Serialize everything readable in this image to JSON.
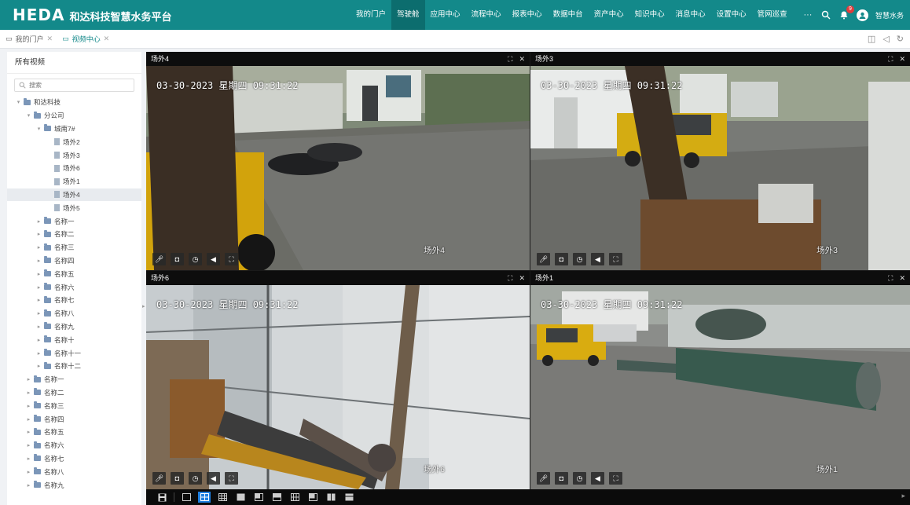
{
  "header": {
    "logo": "HEDA",
    "platform": "和达科技智慧水务平台",
    "nav": [
      {
        "label": "我的门户",
        "active": false
      },
      {
        "label": "驾驶舱",
        "active": true
      },
      {
        "label": "应用中心",
        "active": false
      },
      {
        "label": "流程中心",
        "active": false
      },
      {
        "label": "报表中心",
        "active": false
      },
      {
        "label": "数据中台",
        "active": false
      },
      {
        "label": "资产中心",
        "active": false
      },
      {
        "label": "知识中心",
        "active": false
      },
      {
        "label": "消息中心",
        "active": false
      },
      {
        "label": "设置中心",
        "active": false
      },
      {
        "label": "管网巡查",
        "active": false
      }
    ],
    "notification_count": "9",
    "username": "智慧水务"
  },
  "tabs": [
    {
      "label": "我的门户",
      "active": false
    },
    {
      "label": "视频中心",
      "active": true
    }
  ],
  "sidebar": {
    "title": "所有视频",
    "search_placeholder": "搜索",
    "tree": [
      {
        "label": "和达科技",
        "level": 0,
        "type": "folder",
        "expanded": true
      },
      {
        "label": "分公司",
        "level": 1,
        "type": "folder",
        "expanded": true
      },
      {
        "label": "城南7#",
        "level": 2,
        "type": "folder",
        "expanded": true
      },
      {
        "label": "场外2",
        "level": 3,
        "type": "camera"
      },
      {
        "label": "场外3",
        "level": 3,
        "type": "camera"
      },
      {
        "label": "场外6",
        "level": 3,
        "type": "camera"
      },
      {
        "label": "场外1",
        "level": 3,
        "type": "camera"
      },
      {
        "label": "场外4",
        "level": 3,
        "type": "camera",
        "selected": true
      },
      {
        "label": "场外5",
        "level": 3,
        "type": "camera"
      },
      {
        "label": "名称一",
        "level": 2,
        "type": "folder"
      },
      {
        "label": "名称二",
        "level": 2,
        "type": "folder"
      },
      {
        "label": "名称三",
        "level": 2,
        "type": "folder"
      },
      {
        "label": "名称四",
        "level": 2,
        "type": "folder"
      },
      {
        "label": "名称五",
        "level": 2,
        "type": "folder"
      },
      {
        "label": "名称六",
        "level": 2,
        "type": "folder"
      },
      {
        "label": "名称七",
        "level": 2,
        "type": "folder"
      },
      {
        "label": "名称八",
        "level": 2,
        "type": "folder"
      },
      {
        "label": "名称九",
        "level": 2,
        "type": "folder"
      },
      {
        "label": "名称十",
        "level": 2,
        "type": "folder"
      },
      {
        "label": "名称十一",
        "level": 2,
        "type": "folder"
      },
      {
        "label": "名称十二",
        "level": 2,
        "type": "folder"
      },
      {
        "label": "名称一",
        "level": 1,
        "type": "folder"
      },
      {
        "label": "名称二",
        "level": 1,
        "type": "folder"
      },
      {
        "label": "名称三",
        "level": 1,
        "type": "folder"
      },
      {
        "label": "名称四",
        "level": 1,
        "type": "folder"
      },
      {
        "label": "名称五",
        "level": 1,
        "type": "folder"
      },
      {
        "label": "名称六",
        "level": 1,
        "type": "folder"
      },
      {
        "label": "名称七",
        "level": 1,
        "type": "folder"
      },
      {
        "label": "名称八",
        "level": 1,
        "type": "folder"
      },
      {
        "label": "名称九",
        "level": 1,
        "type": "folder"
      }
    ]
  },
  "panes": [
    {
      "title": "场外4",
      "osd": "03-30-2023 星期四 09:31:22",
      "label": "场外4"
    },
    {
      "title": "场外3",
      "osd": "03-30-2023 星期四 09:31:22",
      "label": "场外3"
    },
    {
      "title": "场外6",
      "osd": "03-30-2023 星期四 09:31:22",
      "label": "场外6"
    },
    {
      "title": "场外1",
      "osd": "03-30-2023 星期四 09:31:22",
      "label": "场外1"
    }
  ]
}
